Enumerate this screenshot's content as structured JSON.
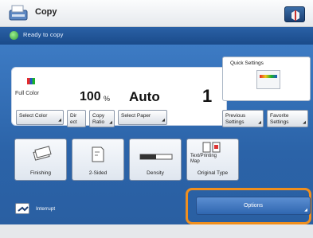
{
  "app": {
    "title": "Copy",
    "icon": "copier-icon"
  },
  "status": {
    "text": "Ready to copy",
    "icon": "status-ok-icon"
  },
  "settings": {
    "color_mode": "Full Color",
    "copy_ratio_value": "100",
    "copy_ratio_unit": "%",
    "paper": "Auto",
    "quantity": "1"
  },
  "buttons": {
    "select_color": "Select Color",
    "direct": "Dir\nect",
    "copy_ratio": "Copy\nRatio",
    "select_paper": "Select Paper",
    "previous_settings": "Previous\nSettings",
    "favorite_settings": "Favorite\nSettings"
  },
  "presets": {
    "label": "Quick Settings"
  },
  "functions": [
    {
      "label": "Finishing",
      "icon": "finishing-icon"
    },
    {
      "label": "2-Sided",
      "icon": "two-sided-icon"
    },
    {
      "label": "Density",
      "icon": "density-icon"
    },
    {
      "label": "Original Type",
      "icon": "original-type-icon",
      "top_label": "Text/Printing\nMap"
    }
  ],
  "interrupt": {
    "label": "Interrupt",
    "icon": "interrupt-icon"
  },
  "options": {
    "label": "Options"
  },
  "colors": {
    "panel_blue": "#2b63a8",
    "highlight_orange": "#f08f1e"
  }
}
